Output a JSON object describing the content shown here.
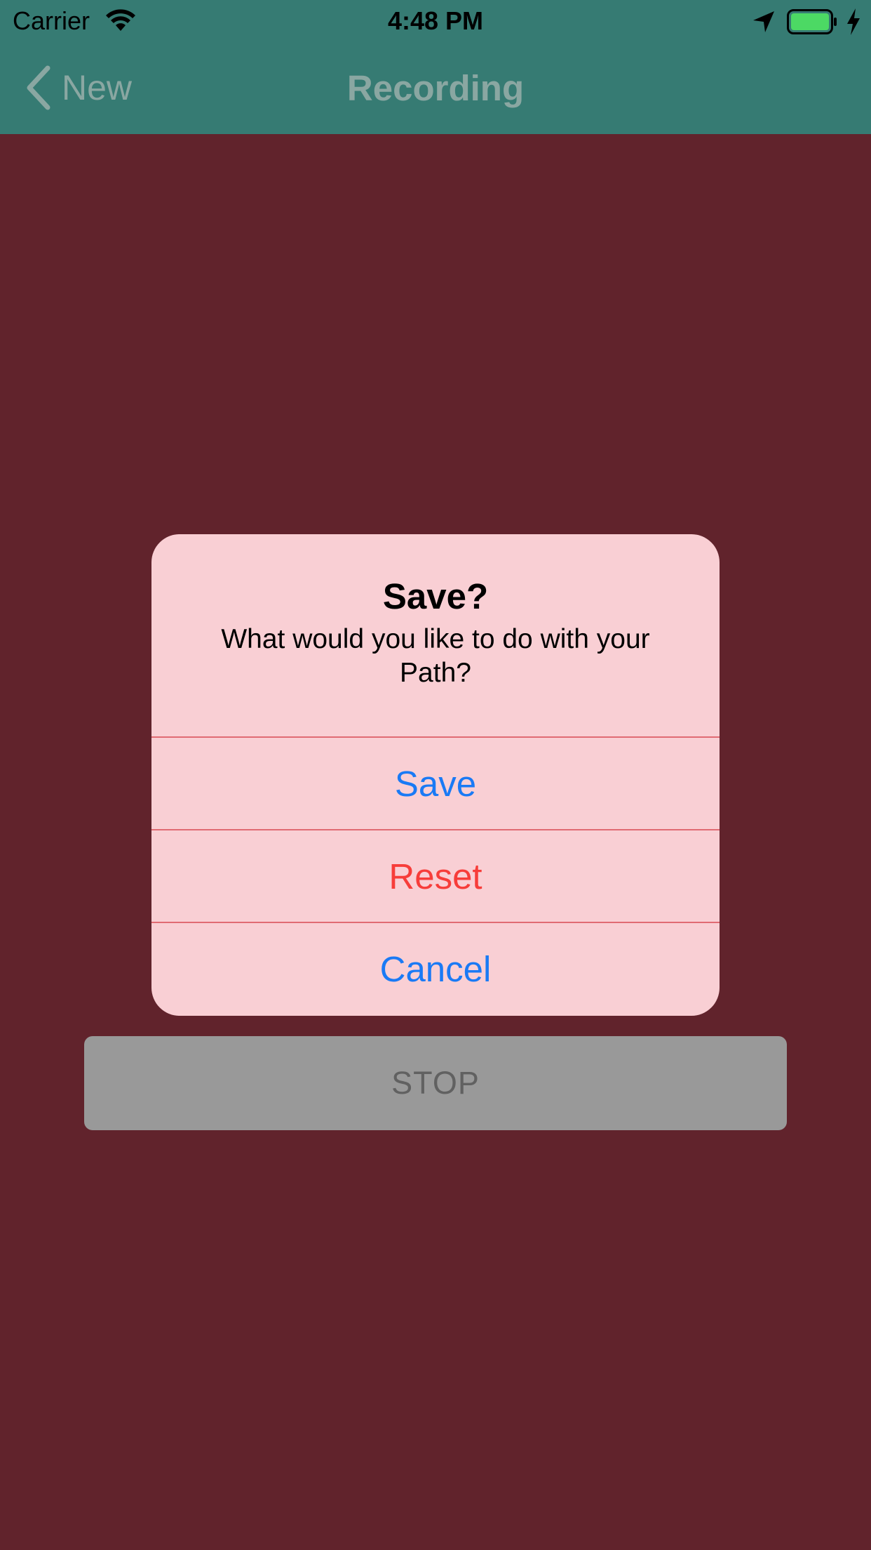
{
  "status_bar": {
    "carrier": "Carrier",
    "time": "4:48 PM",
    "icons": [
      "wifi-icon",
      "location-arrow-icon",
      "battery-icon",
      "charging-bolt-icon"
    ],
    "battery_color": "#4cd964"
  },
  "nav_bar": {
    "back_label": "New",
    "title": "Recording",
    "background_color": "#367b73"
  },
  "main": {
    "background_color": "#61232c",
    "stop_button_label": "STOP"
  },
  "alert": {
    "title": "Save?",
    "message": "What would you like to do with your Path?",
    "actions": [
      {
        "label": "Save",
        "color": "#1a7af5"
      },
      {
        "label": "Reset",
        "color": "#f73d3a"
      },
      {
        "label": "Cancel",
        "color": "#1a7af5"
      }
    ],
    "background_color": "#f9cfd4"
  }
}
